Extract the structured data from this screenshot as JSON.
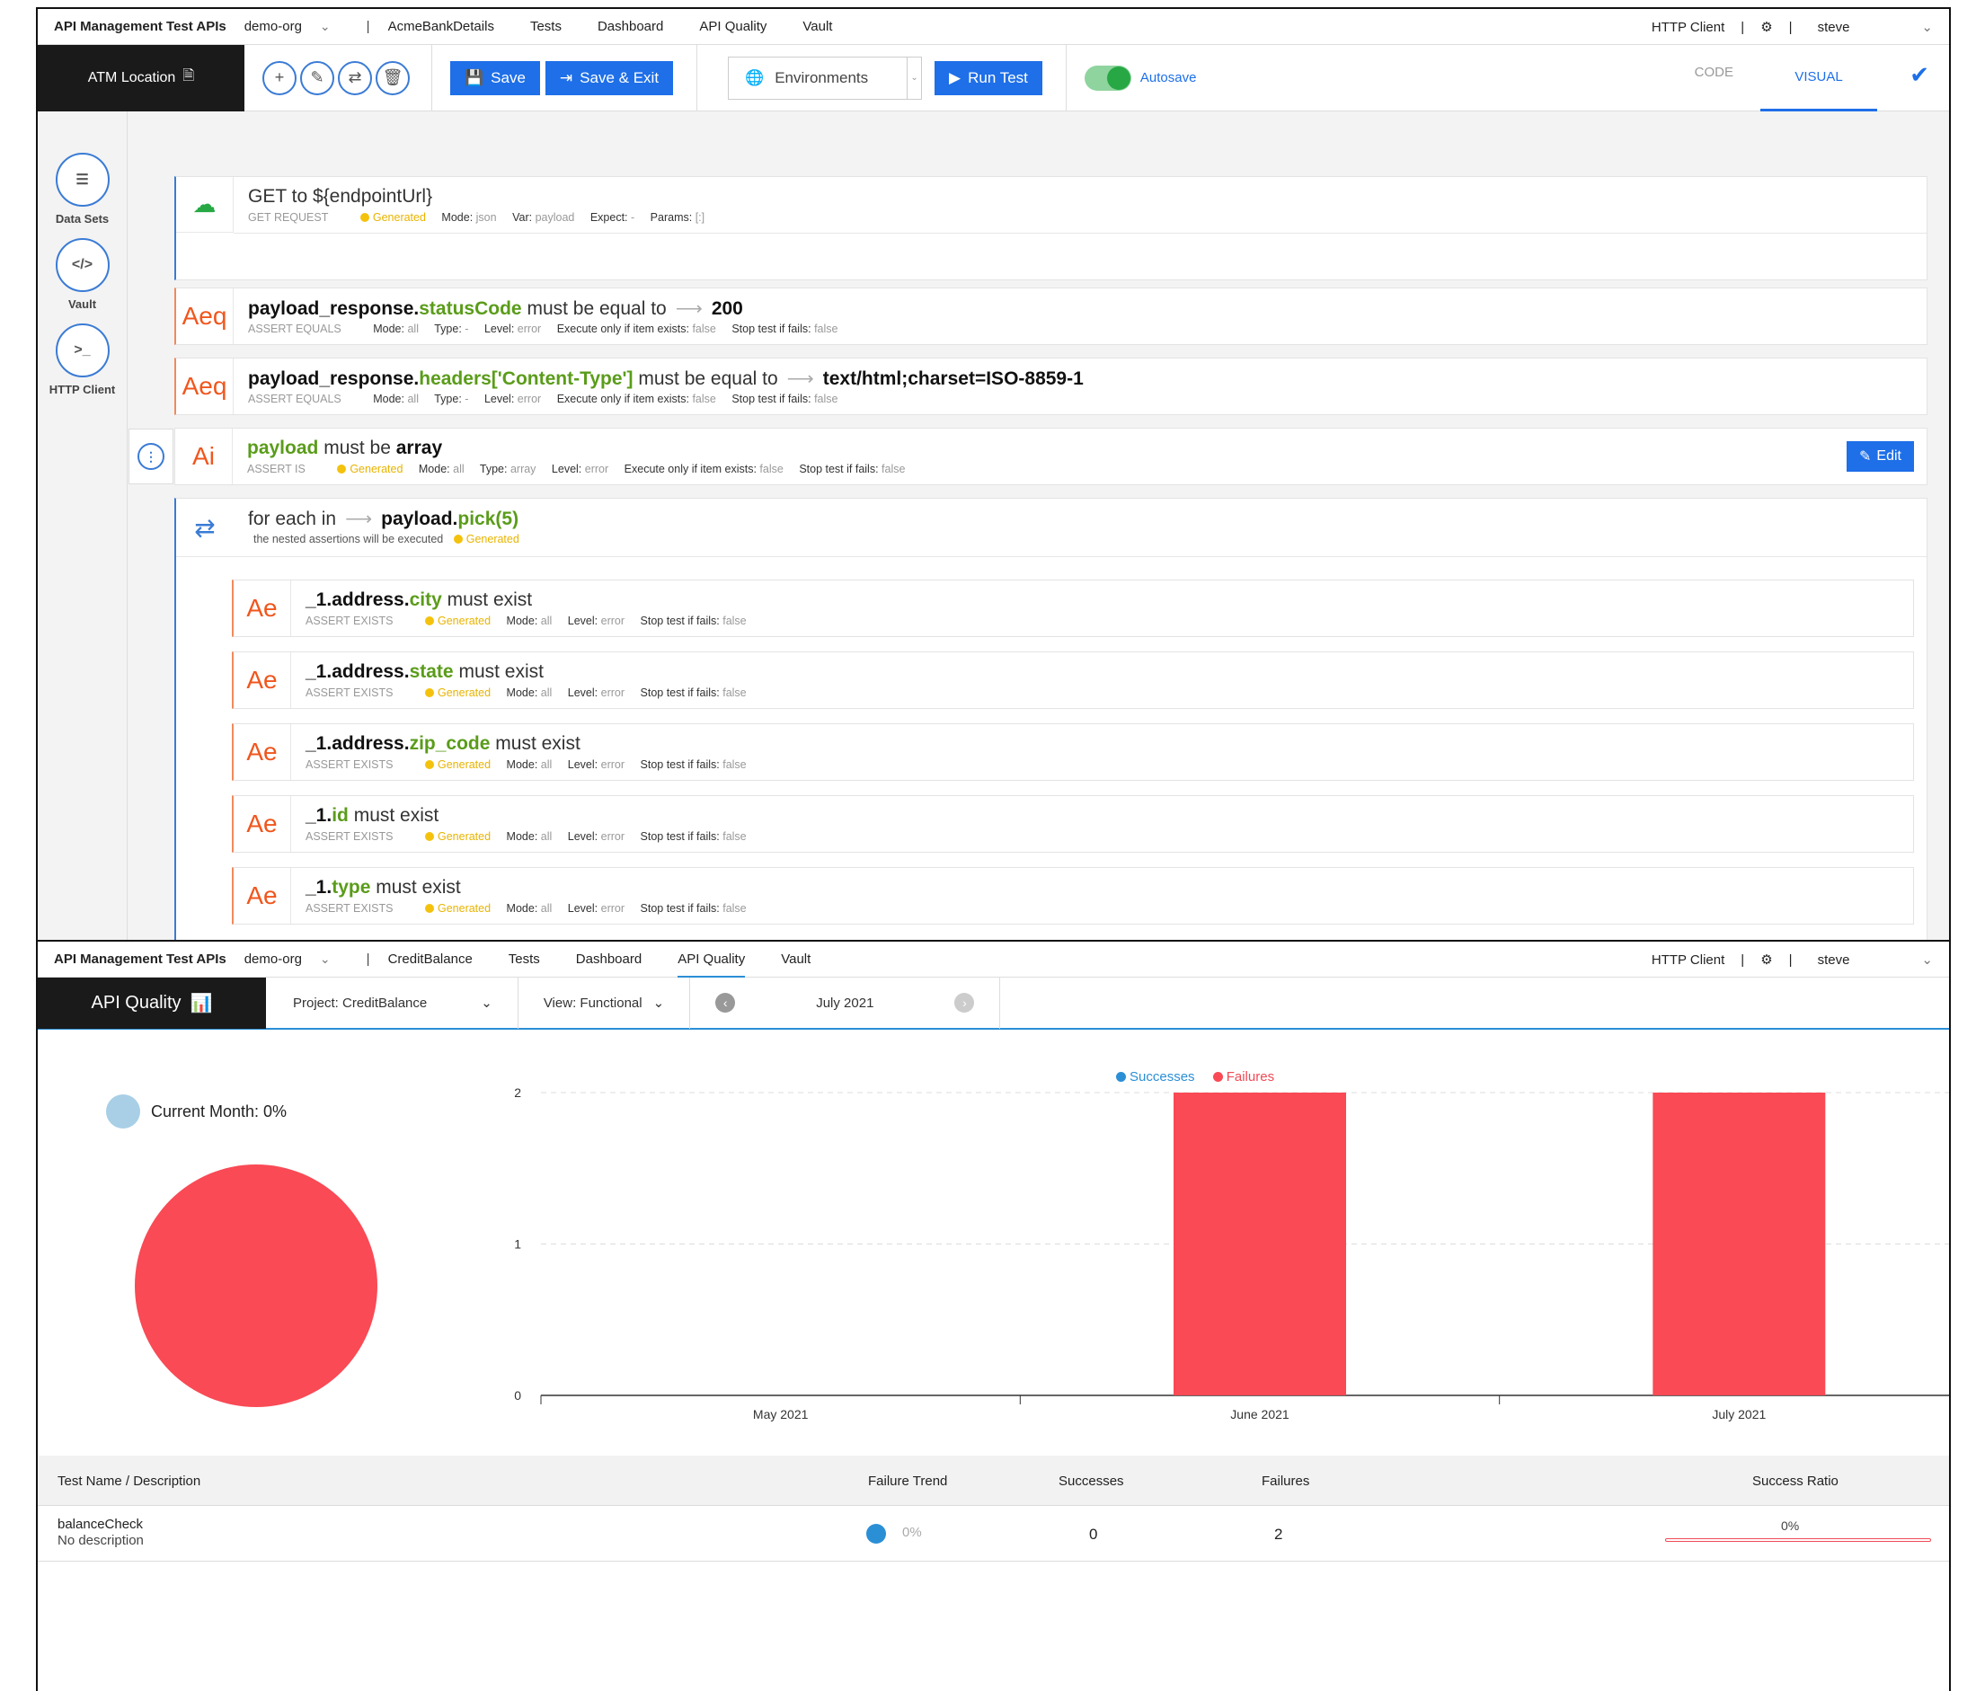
{
  "editor": {
    "nav": {
      "brand": "API Management Test APIs",
      "org": "demo-org",
      "project": "AcmeBankDetails",
      "items": [
        "Tests",
        "Dashboard",
        "API Quality",
        "Vault"
      ],
      "http_client": "HTTP Client",
      "user": "steve"
    },
    "toolbar": {
      "test_name": "ATM Location",
      "save": "Save",
      "save_exit": "Save & Exit",
      "environments": "Environments",
      "run": "Run Test",
      "autosave": "Autosave",
      "code_tab": "CODE",
      "visual_tab": "VISUAL"
    },
    "sidebar": [
      {
        "label": "Data Sets",
        "icon": "list-icon"
      },
      {
        "label": "Vault",
        "icon": "code-icon"
      },
      {
        "label": "HTTP Client",
        "icon": "terminal-icon"
      }
    ],
    "get": {
      "title": "GET to ${endpointUrl}",
      "kind": "GET REQUEST",
      "generated": "Generated",
      "mode_k": "Mode:",
      "mode_v": "json",
      "var_k": "Var:",
      "var_v": "payload",
      "expect_k": "Expect:",
      "expect_v": "-",
      "params_k": "Params:",
      "params_v": "[:]"
    },
    "assert1": {
      "badge": "Aeq",
      "p1": "payload_response.",
      "p2": "statusCode",
      "p3": "must be equal to",
      "p4": "200",
      "kind": "ASSERT EQUALS",
      "mode_k": "Mode:",
      "mode_v": "all",
      "type_k": "Type:",
      "type_v": "-",
      "level_k": "Level:",
      "level_v": "error",
      "exec_k": "Execute only if item exists:",
      "exec_v": "false",
      "stop_k": "Stop test if fails:",
      "stop_v": "false"
    },
    "assert2": {
      "badge": "Aeq",
      "p1": "payload_response.",
      "p2": "headers['Content-Type']",
      "p3": "must be equal to",
      "p4": "text/html;charset=ISO-8859-1",
      "kind": "ASSERT EQUALS",
      "mode_k": "Mode:",
      "mode_v": "all",
      "type_k": "Type:",
      "type_v": "-",
      "level_k": "Level:",
      "level_v": "error",
      "exec_k": "Execute only if item exists:",
      "exec_v": "false",
      "stop_k": "Stop test if fails:",
      "stop_v": "false"
    },
    "assert3": {
      "badge": "Ai",
      "p1": "payload",
      "p2": "must be",
      "p3": "array",
      "kind": "ASSERT IS",
      "generated": "Generated",
      "mode_k": "Mode:",
      "mode_v": "all",
      "type_k": "Type:",
      "type_v": "array",
      "level_k": "Level:",
      "level_v": "error",
      "exec_k": "Execute only if item exists:",
      "exec_v": "false",
      "stop_k": "Stop test if fails:",
      "stop_v": "false",
      "edit": "Edit"
    },
    "foreach": {
      "p1": "for each in",
      "p2": "payload.",
      "p3": "pick(5)",
      "desc": "the nested assertions will be executed",
      "generated": "Generated"
    },
    "exists": [
      {
        "badge": "Ae",
        "p1": "_1.address.",
        "p2": "city",
        "p3": "must exist"
      },
      {
        "badge": "Ae",
        "p1": "_1.address.",
        "p2": "state",
        "p3": "must exist"
      },
      {
        "badge": "Ae",
        "p1": "_1.address.",
        "p2": "zip_code",
        "p3": "must exist"
      },
      {
        "badge": "Ae",
        "p1": "_1.",
        "p2": "id",
        "p3": "must exist"
      },
      {
        "badge": "Ae",
        "p1": "_1.",
        "p2": "type",
        "p3": "must exist"
      }
    ],
    "exists_meta": {
      "kind": "ASSERT EXISTS",
      "generated": "Generated",
      "mode_k": "Mode:",
      "mode_v": "all",
      "level_k": "Level:",
      "level_v": "error",
      "stop_k": "Stop test if fails:",
      "stop_v": "false"
    }
  },
  "quality": {
    "nav": {
      "brand": "API Management Test APIs",
      "org": "demo-org",
      "project": "CreditBalance",
      "items": [
        "Tests",
        "Dashboard",
        "API Quality",
        "Vault"
      ],
      "http_client": "HTTP Client",
      "user": "steve"
    },
    "toolbar": {
      "title": "API Quality",
      "project": "Project: CreditBalance",
      "view": "View: Functional",
      "month": "July 2021"
    },
    "current_month": "Current Month: 0%",
    "table": {
      "headers": [
        "Test Name / Description",
        "Failure Trend",
        "Successes",
        "Failures",
        "Success Ratio"
      ],
      "row": {
        "name": "balanceCheck",
        "desc": "No description",
        "trend": "0%",
        "successes": "0",
        "failures": "2",
        "ratio": "0%"
      }
    }
  },
  "chart_data": [
    {
      "type": "pie",
      "title": "Current Month: 0%",
      "slices": [
        {
          "label": "Failures",
          "value": 100,
          "color": "#f94a55"
        },
        {
          "label": "Successes",
          "value": 0,
          "color": "#2b8fd6"
        }
      ]
    },
    {
      "type": "bar",
      "categories": [
        "May 2021",
        "June 2021",
        "July 2021"
      ],
      "series": [
        {
          "name": "Successes",
          "color": "#2b8fd6",
          "values": [
            0,
            0,
            0
          ]
        },
        {
          "name": "Failures",
          "color": "#f94a55",
          "values": [
            0,
            2,
            2
          ]
        }
      ],
      "ylim": [
        0,
        2
      ],
      "yticks": [
        0,
        1,
        2
      ],
      "legend": "top",
      "grid": true
    }
  ]
}
